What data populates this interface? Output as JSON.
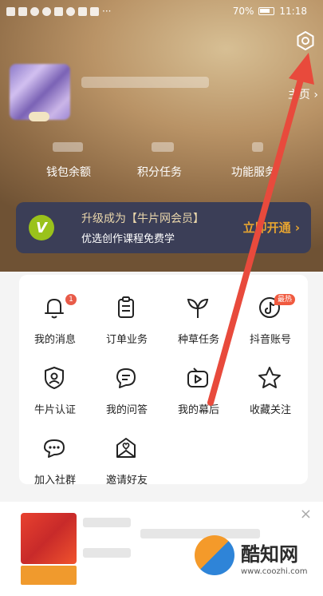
{
  "status_bar": {
    "battery": "70%",
    "time": "11:18",
    "more": "···"
  },
  "header": {
    "homepage_link": "主页 ›"
  },
  "stats": [
    {
      "label": "钱包余额"
    },
    {
      "label": "积分任务"
    },
    {
      "label": "功能服务"
    }
  ],
  "vip": {
    "logo": "V",
    "title": "升级成为【牛片网会员】",
    "subtitle": "优选创作课程免费学",
    "button": "立即开通 ›"
  },
  "grid": [
    {
      "label": "我的消息",
      "icon": "bell-icon",
      "badge": "1"
    },
    {
      "label": "订单业务",
      "icon": "clipboard-icon"
    },
    {
      "label": "种草任务",
      "icon": "sprout-icon"
    },
    {
      "label": "抖音账号",
      "icon": "tiktok-icon",
      "badge": "最热"
    },
    {
      "label": "牛片认证",
      "icon": "shield-user-icon"
    },
    {
      "label": "我的问答",
      "icon": "chat-bubble-icon"
    },
    {
      "label": "我的幕后",
      "icon": "video-play-icon"
    },
    {
      "label": "收藏关注",
      "icon": "star-icon"
    },
    {
      "label": "加入社群",
      "icon": "group-chat-icon"
    },
    {
      "label": "邀请好友",
      "icon": "heart-envelope-icon"
    }
  ],
  "feed": {
    "close": "×"
  },
  "watermark": {
    "text": "酷知网",
    "url": "www.coozhi.com"
  },
  "colors": {
    "vip_bg": "#3b3e57",
    "vip_button": "#e8a530",
    "accent_red": "#e85b49",
    "annotation_arrow": "#e84a3c"
  }
}
